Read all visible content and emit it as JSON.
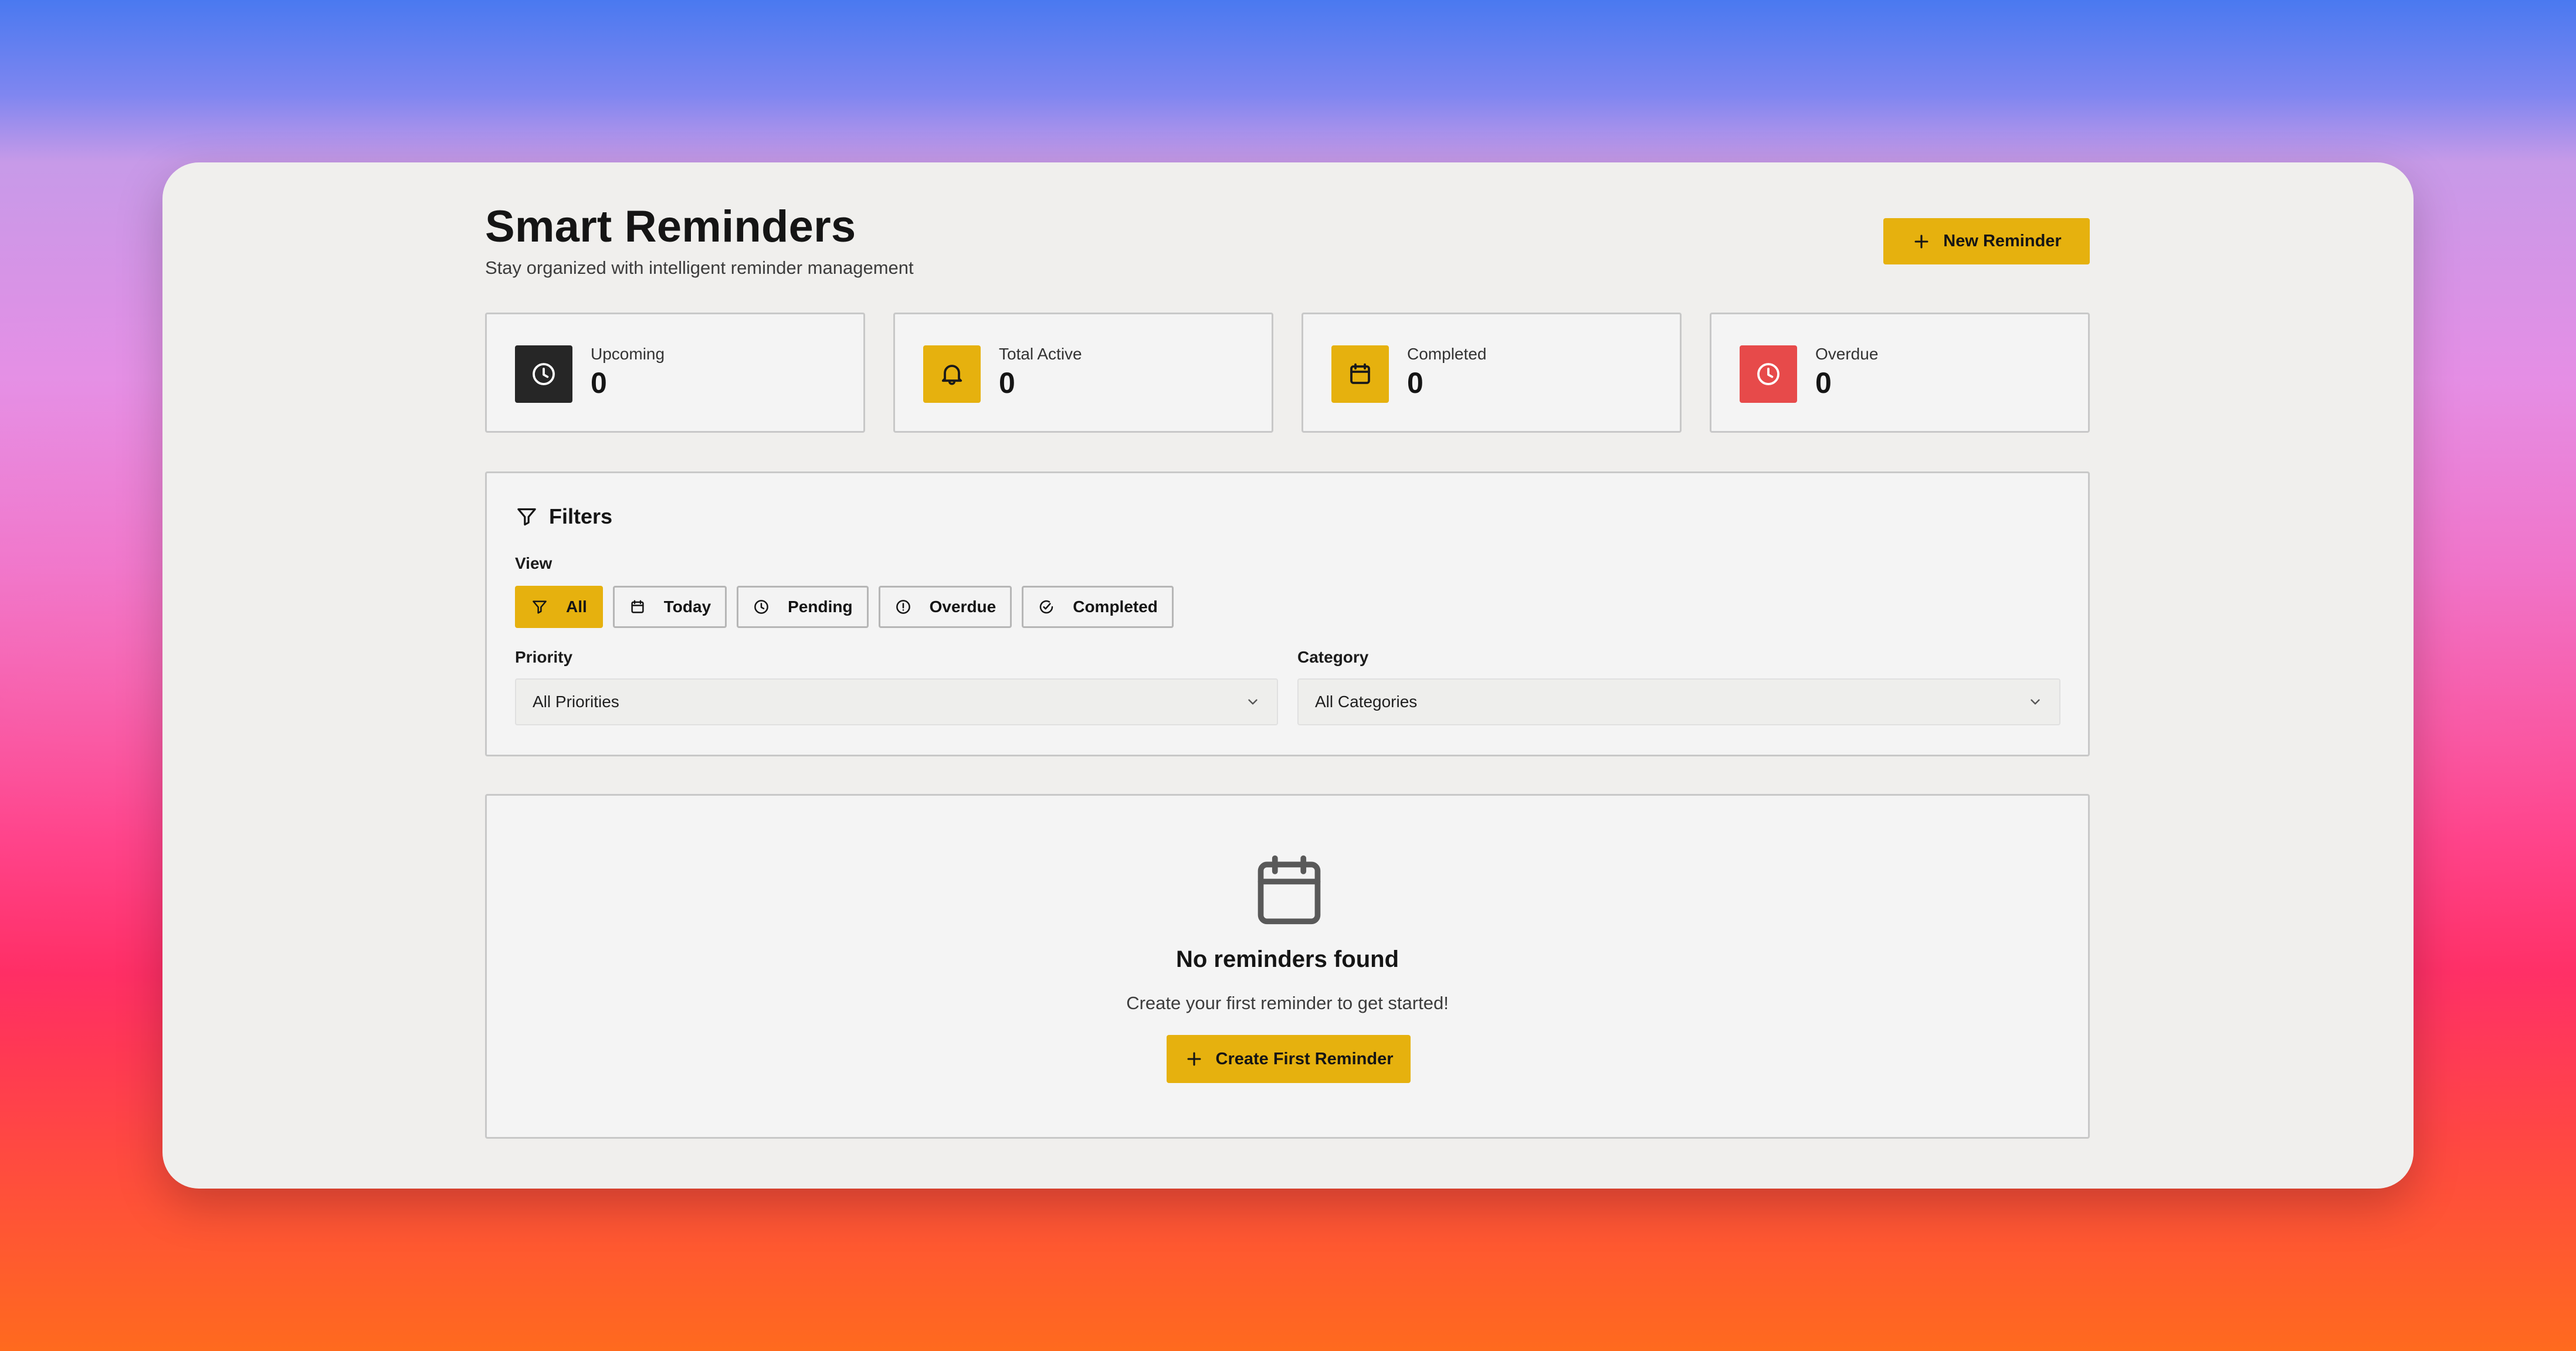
{
  "header": {
    "title": "Smart Reminders",
    "subtitle": "Stay organized with intelligent reminder management",
    "new_button": "New Reminder"
  },
  "stats": [
    {
      "label": "Upcoming",
      "value": "0",
      "icon": "clock-icon",
      "color": "#262626"
    },
    {
      "label": "Total Active",
      "value": "0",
      "icon": "bell-icon",
      "color": "#e6b10e"
    },
    {
      "label": "Completed",
      "value": "0",
      "icon": "calendar-icon",
      "color": "#e6b10e"
    },
    {
      "label": "Overdue",
      "value": "0",
      "icon": "clock-icon",
      "color": "#e74a4a"
    }
  ],
  "filters": {
    "title": "Filters",
    "view_label": "View",
    "view_tabs": [
      {
        "label": "All",
        "icon": "filter-icon",
        "active": true
      },
      {
        "label": "Today",
        "icon": "calendar-icon",
        "active": false
      },
      {
        "label": "Pending",
        "icon": "clock-icon",
        "active": false
      },
      {
        "label": "Overdue",
        "icon": "alert-circle-icon",
        "active": false
      },
      {
        "label": "Completed",
        "icon": "check-circle-icon",
        "active": false
      }
    ],
    "priority": {
      "label": "Priority",
      "value": "All Priorities"
    },
    "category": {
      "label": "Category",
      "value": "All Categories"
    }
  },
  "empty_state": {
    "title": "No reminders found",
    "description": "Create your first reminder to get started!",
    "button": "Create First Reminder"
  },
  "colors": {
    "accent": "#e6b10e",
    "danger": "#e74a4a",
    "dark": "#262626",
    "border": "#c8c8c8",
    "card": "#f4f4f4"
  }
}
